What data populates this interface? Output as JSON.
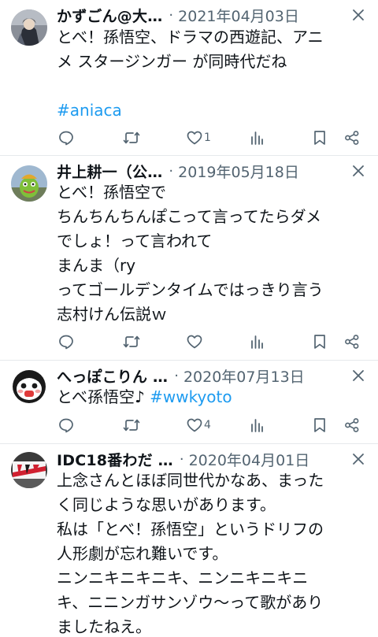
{
  "tweets": [
    {
      "author": "かずごん@大…",
      "date": "2021年04月03日",
      "lines": [
        "とべ！孫悟空、ドラマの西遊記、アニ",
        "メ スタージンガー が同時代だね"
      ],
      "hashtag": "#aniaca",
      "like_count": "1",
      "avatar_icon": "anime-character-avatar-icon"
    },
    {
      "author": "井上耕一（公…",
      "date": "2019年05月18日",
      "lines": [
        "とべ！孫悟空で",
        "ちんちんちんぽこって言ってたらダメ",
        "でしょ！って言われて",
        "まんま（ry",
        "ってゴールデンタイムではっきり言う",
        "志村けん伝説ｗ"
      ],
      "like_count": "",
      "avatar_icon": "costume-character-avatar-icon"
    },
    {
      "author": "へっぽこりん …",
      "date": "2020年07月13日",
      "text": "とべ孫悟空♪ ",
      "hashtag": "#wwkyoto",
      "like_count": "4",
      "avatar_icon": "cartoon-face-avatar-icon"
    },
    {
      "author": "IDC18番わだ …",
      "date": "2020年04月01日",
      "lines": [
        "上念さんとほぼ同世代かなあ、まった",
        "く同じような思いがあります。",
        "私は「とべ！孫悟空」というドリフの",
        "人形劇が忘れ難いです。",
        "ニンニキニキニキ、ニンニキニキニ",
        "キ、ニニンガサンゾウ〜って歌があり",
        "ましたねえ。"
      ],
      "avatar_icon": "station-sign-avatar-icon"
    }
  ],
  "dot": "·",
  "colors": {
    "text": "#0f1419",
    "secondary": "#536471",
    "link": "#1d9bf0",
    "divider": "#e6e9ec"
  }
}
